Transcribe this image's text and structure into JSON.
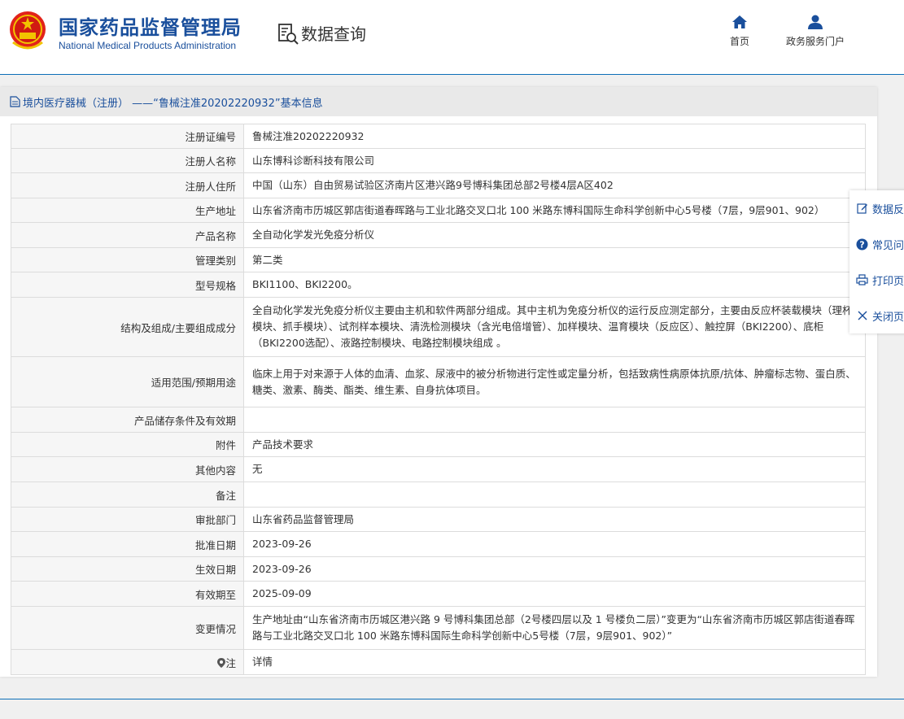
{
  "header": {
    "org_cn": "国家药品监督管理局",
    "org_en": "National Medical Products Administration",
    "data_query": "数据查询",
    "nav": {
      "home": "首页",
      "portal": "政务服务门户"
    }
  },
  "panel": {
    "title": "境内医疗器械（注册） ——“鲁械注准20202220932”基本信息",
    "rows": [
      {
        "key": "注册证编号",
        "value": "鲁械注准20202220932"
      },
      {
        "key": "注册人名称",
        "value": "山东博科诊断科技有限公司"
      },
      {
        "key": "注册人住所",
        "value": "中国（山东）自由贸易试验区济南片区港兴路9号博科集团总部2号楼4层A区402"
      },
      {
        "key": "生产地址",
        "value": "山东省济南市历城区郭店街道春晖路与工业北路交叉口北 100 米路东博科国际生命科学创新中心5号楼（7层，9层901、902）"
      },
      {
        "key": "产品名称",
        "value": "全自动化学发光免疫分析仪"
      },
      {
        "key": "管理类别",
        "value": "第二类"
      },
      {
        "key": "型号规格",
        "value": "BKI1100、BKI2200。"
      },
      {
        "key": "结构及组成/主要组成成分",
        "value": "全自动化学发光免疫分析仪主要由主机和软件两部分组成。其中主机为免疫分析仪的运行反应测定部分，主要由反应杯装载模块（理杯模块、抓手模块）、试剂样本模块、清洗检测模块（含光电倍增管）、加样模块、温育模块（反应区）、触控屏（BKI2200）、底柜（BKI2200选配）、液路控制模块、电路控制模块组成 。"
      },
      {
        "key": "适用范围/预期用途",
        "value": "临床上用于对来源于人体的血清、血浆、尿液中的被分析物进行定性或定量分析，包括致病性病原体抗原/抗体、肿瘤标志物、蛋白质、糖类、激素、酶类、酯类、维生素、自身抗体项目。"
      },
      {
        "key": "产品储存条件及有效期",
        "value": ""
      },
      {
        "key": "附件",
        "value": "产品技术要求"
      },
      {
        "key": "其他内容",
        "value": "无"
      },
      {
        "key": "备注",
        "value": ""
      },
      {
        "key": "审批部门",
        "value": "山东省药品监督管理局"
      },
      {
        "key": "批准日期",
        "value": "2023-09-26"
      },
      {
        "key": "生效日期",
        "value": "2023-09-26"
      },
      {
        "key": "有效期至",
        "value": "2025-09-09"
      },
      {
        "key": "变更情况",
        "value": "生产地址由“山东省济南市历城区港兴路 9 号博科集团总部（2号楼四层以及 1 号楼负二层）”变更为“山东省济南市历城区郭店街道春晖路与工业北路交叉口北 100 米路东博科国际生命科学创新中心5号楼（7层，9层901、902）”"
      },
      {
        "key": "注",
        "value": "详情"
      }
    ]
  },
  "float_menu": {
    "items": [
      {
        "label": "数据反馈",
        "icon": "edit-icon"
      },
      {
        "label": "常见问题",
        "icon": "question-icon"
      },
      {
        "label": "打印页面",
        "icon": "print-icon"
      },
      {
        "label": "关闭页面",
        "icon": "close-icon"
      }
    ]
  },
  "colors": {
    "brand": "#1a4f9c",
    "link": "#1a6fc0",
    "accent_line": "#0d6fb8"
  }
}
